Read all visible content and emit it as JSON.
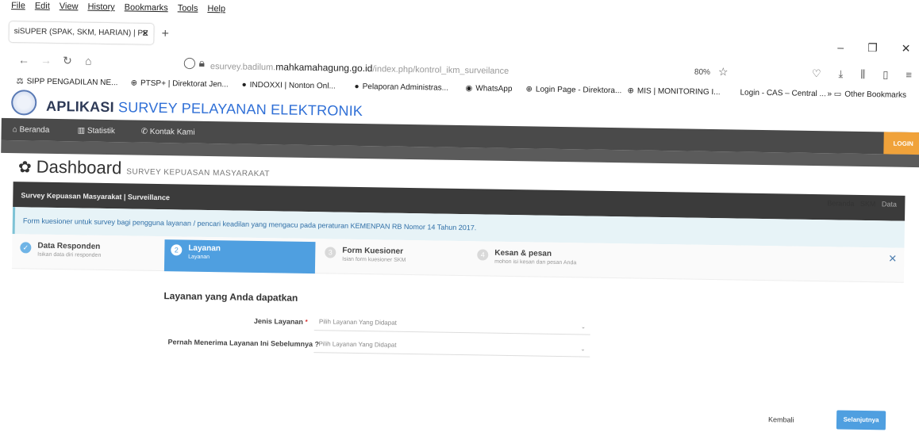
{
  "browser": {
    "menu": [
      "File",
      "Edit",
      "View",
      "History",
      "Bookmarks",
      "Tools",
      "Help"
    ],
    "tab_title": "siSUPER (SPAK, SKM, HARIAN) | PE",
    "url_prefix": "esurvey.badilum.",
    "url_domain": "mahkamahagung.go.id",
    "url_path": "/index.php/kontrol_ikm_surveilance",
    "zoom": "80%",
    "bookmarks": [
      "SIPP PENGADILAN NE...",
      "PTSP+ | Direktorat Jen...",
      "INDOXXI | Nonton Onl...",
      "Pelaporan Administras...",
      "WhatsApp",
      "Login Page - Direktora...",
      "MIS | MONITORING I...",
      "Login - CAS – Central ...",
      "Other Bookmarks"
    ]
  },
  "app": {
    "title_part1": "APLIKASI ",
    "title_part2": "SURVEY PELAYANAN ELEKTRONIK",
    "nav": [
      "Beranda",
      "Statistik",
      "Kontak Kami"
    ],
    "login": "LOGIN"
  },
  "dashboard": {
    "title": "Dashboard",
    "subtitle": "SURVEY KEPUASAN MASYARAKAT"
  },
  "panel": {
    "title": "Survey Kepuasan Masyarakat | Surveillance",
    "crumbs": [
      "Beranda",
      "SKM",
      "Data"
    ],
    "info": "Form kuesioner untuk survey bagi pengguna layanan / pencari keadilan yang mengacu pada peraturan KEMENPAN RB Nomor 14 Tahun 2017."
  },
  "steps": [
    {
      "title": "Data Responden",
      "sub": "Isikan data diri responden",
      "num": "✓"
    },
    {
      "title": "Layanan",
      "sub": "Layanan",
      "num": "2"
    },
    {
      "title": "Form Kuesioner",
      "sub": "Isian form kuesioner SKM",
      "num": "3"
    },
    {
      "title": "Kesan & pesan",
      "sub": "mohon isi kesan dan pesan Anda",
      "num": "4"
    }
  ],
  "form": {
    "section": "Layanan yang Anda dapatkan",
    "field1_label": "Jenis Layanan",
    "field1_req": "*",
    "field1_placeholder": "Pilih Layanan Yang Didapat",
    "field2_label": "Pernah Menerima Layanan Ini Sebelumnya ?",
    "field2_placeholder": "Pilih Layanan Yang Didapat"
  },
  "actions": {
    "back": "Kembali",
    "next": "Selanjutnya"
  }
}
